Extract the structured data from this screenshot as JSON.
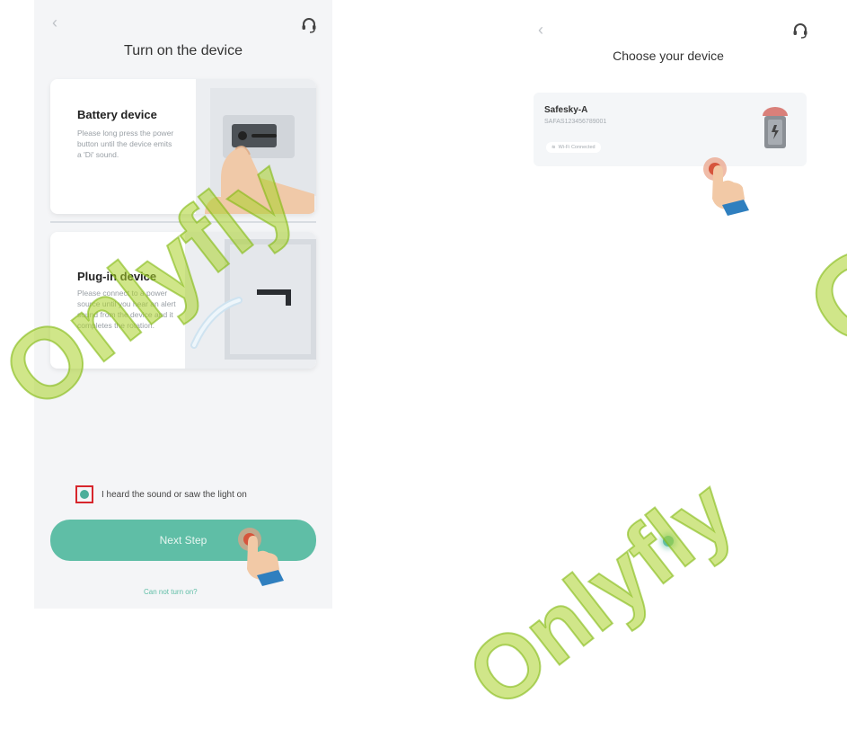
{
  "left_screen": {
    "title": "Turn on the device",
    "back_icon": "chevron-left-icon",
    "support_icon": "headset-icon",
    "battery_card": {
      "title": "Battery device",
      "description": "Please long press the power button until the device emits a 'Di' sound."
    },
    "plugin_card": {
      "title": "Plug-in device",
      "description": "Please connect to a power source until you hear an alert sound from the device and it completes the rotation."
    },
    "confirm_checkbox": {
      "checked": true,
      "label": "I heard the sound or saw the light on"
    },
    "next_button": {
      "label": "Next Step"
    },
    "help_link": "Can not turn on?"
  },
  "right_screen": {
    "title": "Choose your device",
    "back_icon": "chevron-left-icon",
    "support_icon": "headset-icon",
    "device": {
      "name": "Safesky-A",
      "id": "SAFAS123456789001",
      "wifi_status": "Wi-Fi Connected"
    }
  },
  "watermark_text": "Onlyfly",
  "colors": {
    "accent": "#5fbea6",
    "highlight": "#d7262c",
    "watermark": "#aad228",
    "screen_bg": "#f4f5f7"
  }
}
